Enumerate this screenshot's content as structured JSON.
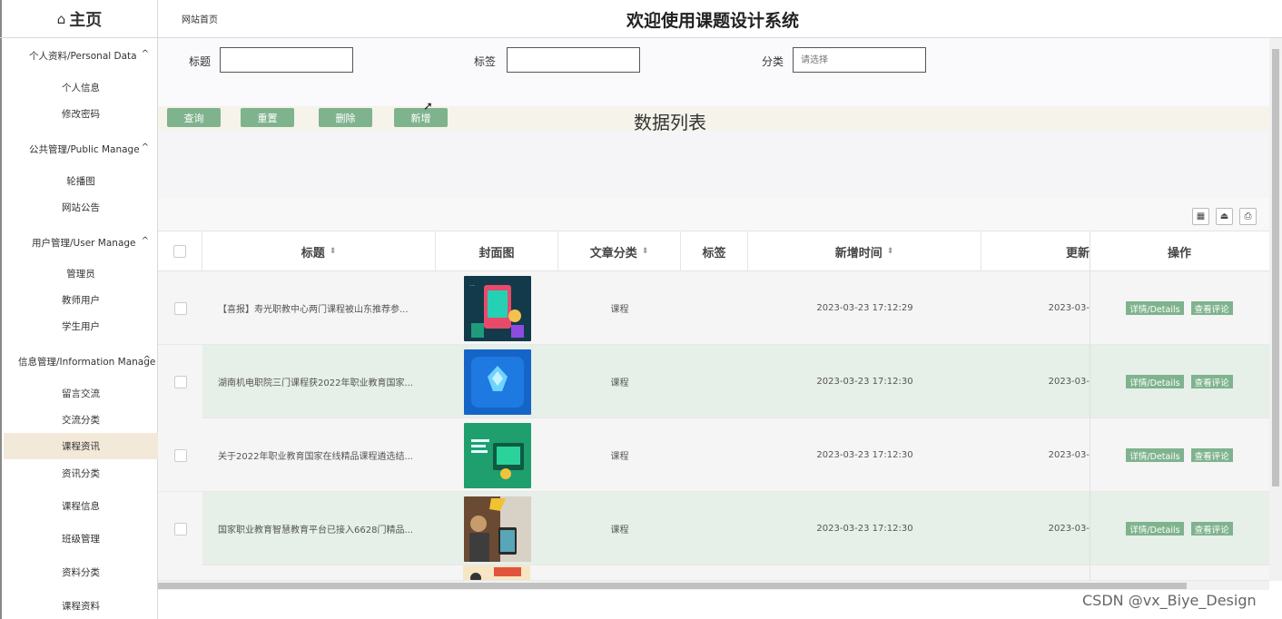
{
  "header": {
    "home_icon": "home-icon",
    "home_label": "主页",
    "breadcrumb": "网站首页",
    "system_title": "欢迎使用课题设计系统"
  },
  "sidebar": {
    "groups": [
      {
        "label": "个人资料/Personal Data",
        "caret": "^",
        "items": [
          "个人信息",
          "修改密码"
        ]
      },
      {
        "label": "公共管理/Public Manage",
        "caret": "^",
        "items": [
          "轮播图",
          "网站公告"
        ]
      },
      {
        "label": "用户管理/User Manage",
        "caret": "^",
        "items": [
          "管理员",
          "教师用户",
          "学生用户"
        ]
      },
      {
        "label": "信息管理/Information Manage",
        "caret": "^",
        "items": [
          "留言交流",
          "交流分类",
          "课程资讯",
          "资讯分类",
          "课程信息",
          "班级管理",
          "资料分类",
          "课程资料"
        ]
      }
    ],
    "active_item": "课程资讯"
  },
  "search": {
    "title_label": "标题",
    "tag_label": "标签",
    "category_label": "分类",
    "category_placeholder": "请选择",
    "title_value": "",
    "tag_value": ""
  },
  "actions": {
    "query": "查询",
    "reset": "重置",
    "delete": "删除",
    "add": "新增"
  },
  "list_title": "数据列表",
  "toolbar_icons": [
    "columns-icon",
    "export-icon",
    "print-icon"
  ],
  "table": {
    "columns": [
      "标题",
      "封面图",
      "文章分类",
      "标签",
      "新增时间",
      "更新",
      "操作"
    ],
    "rows": [
      {
        "title": "【喜报】寿光职教中心两门课程被山东推荐参...",
        "category": "课程",
        "tag": "",
        "added": "2023-03-23 17:12:29",
        "updated": "2023-03-"
      },
      {
        "title": "湖南机电职院三门课程获2022年职业教育国家...",
        "category": "课程",
        "tag": "",
        "added": "2023-03-23 17:12:30",
        "updated": "2023-03-"
      },
      {
        "title": "关于2022年职业教育国家在线精品课程遴选结...",
        "category": "课程",
        "tag": "",
        "added": "2023-03-23 17:12:30",
        "updated": "2023-03-"
      },
      {
        "title": "国家职业教育智慧教育平台已接入6628门精品...",
        "category": "课程",
        "tag": "",
        "added": "2023-03-23 17:12:30",
        "updated": "2023-03-"
      }
    ],
    "detail_btn": "详情/Details",
    "comment_btn": "查看评论"
  },
  "watermark": "CSDN @vx_Biye_Design",
  "colors": {
    "accent": "#7fb38e",
    "row_alt": "#e6efe8",
    "active_bg": "#f3e9d9"
  }
}
